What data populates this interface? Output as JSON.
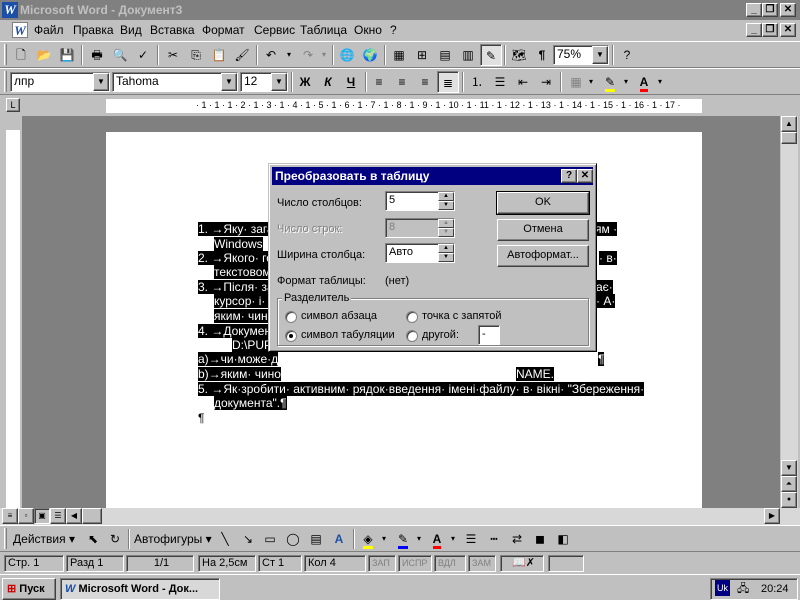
{
  "window": {
    "title": "Microsoft Word - Документ3"
  },
  "menu": [
    "Файл",
    "Правка",
    "Вид",
    "Вставка",
    "Формат",
    "Сервис",
    "Таблица",
    "Окно",
    "?"
  ],
  "toolbar": {
    "zoom": "75%",
    "style": "лпр",
    "font": "Tahoma",
    "size": "12",
    "bold": "Ж",
    "italic": "К",
    "underline": "Ч"
  },
  "ruler": {
    "text": "· 1 · 1 · 1 · 2 · 1 · 3 · 1 · 4 · 1 · 5 · 1 · 6 · 1 · 7 · 1 · 8 · 1 · 9 · 1 · 10 · 1 · 11 · 1 · 12 · 1 · 13 · 1 · 14 · 1 · 15 · 1 · 16 · 1 · 17 ·"
  },
  "document": {
    "lines": [
      "1. →Яку· загал",
      "Windows",
      "2. →Якого· гол",
      "текстовом",
      "3. →Після· зап",
      "курсор· і· з",
      "яким· чинс",
      "4. →Документ",
      "D:\\PUP",
      "а)→чи·може·д",
      "b)→яким· чино",
      "5. →Як·зробити· активним· рядок·введення· імені·файлу· в· вікні· \"Збереження·",
      "документа\".¶",
      "¶"
    ],
    "fragments": [
      "ям ·",
      "· в·",
      "ає·",
      "· А·",
      "¶",
      "NAME."
    ]
  },
  "dialog": {
    "title": "Преобразовать в таблицу",
    "help": "?",
    "close": "✕",
    "cols_label": "Число столбцов:",
    "cols_value": "5",
    "rows_label": "Число строк:",
    "rows_value": "8",
    "width_label": "Ширина столбца:",
    "width_value": "Авто",
    "format_label": "Формат таблицы:",
    "format_value": "(нет)",
    "ok": "OK",
    "cancel": "Отмена",
    "autoformat": "Автоформат...",
    "separator_title": "Разделитель",
    "sep_paragraph": "символ абзаца",
    "sep_tab": "символ табуляции",
    "sep_semicolon": "точка с запятой",
    "sep_other": "другой:",
    "sep_other_value": "-",
    "selected_separator": "символ табуляции"
  },
  "drawbar": {
    "actions": "Действия",
    "autoshapes": "Автофигуры"
  },
  "status": {
    "page": "Стр. 1",
    "section": "Разд 1",
    "pages": "1/1",
    "at": "На 2,5см",
    "line": "Ст 1",
    "col": "Кол 4",
    "rec": "ЗАП",
    "trk": "ИСПР",
    "ext": "ВДЛ",
    "ovr": "ЗАМ"
  },
  "taskbar": {
    "start": "Пуск",
    "task": "Microsoft Word - Док...",
    "lang": "Uk",
    "time": "20:24"
  },
  "colors": {
    "title_active": "#000080",
    "title_inactive": "#808080",
    "face": "#c0c0c0",
    "highlight_yellow": "#ffff00",
    "font_red": "#ff0000"
  }
}
